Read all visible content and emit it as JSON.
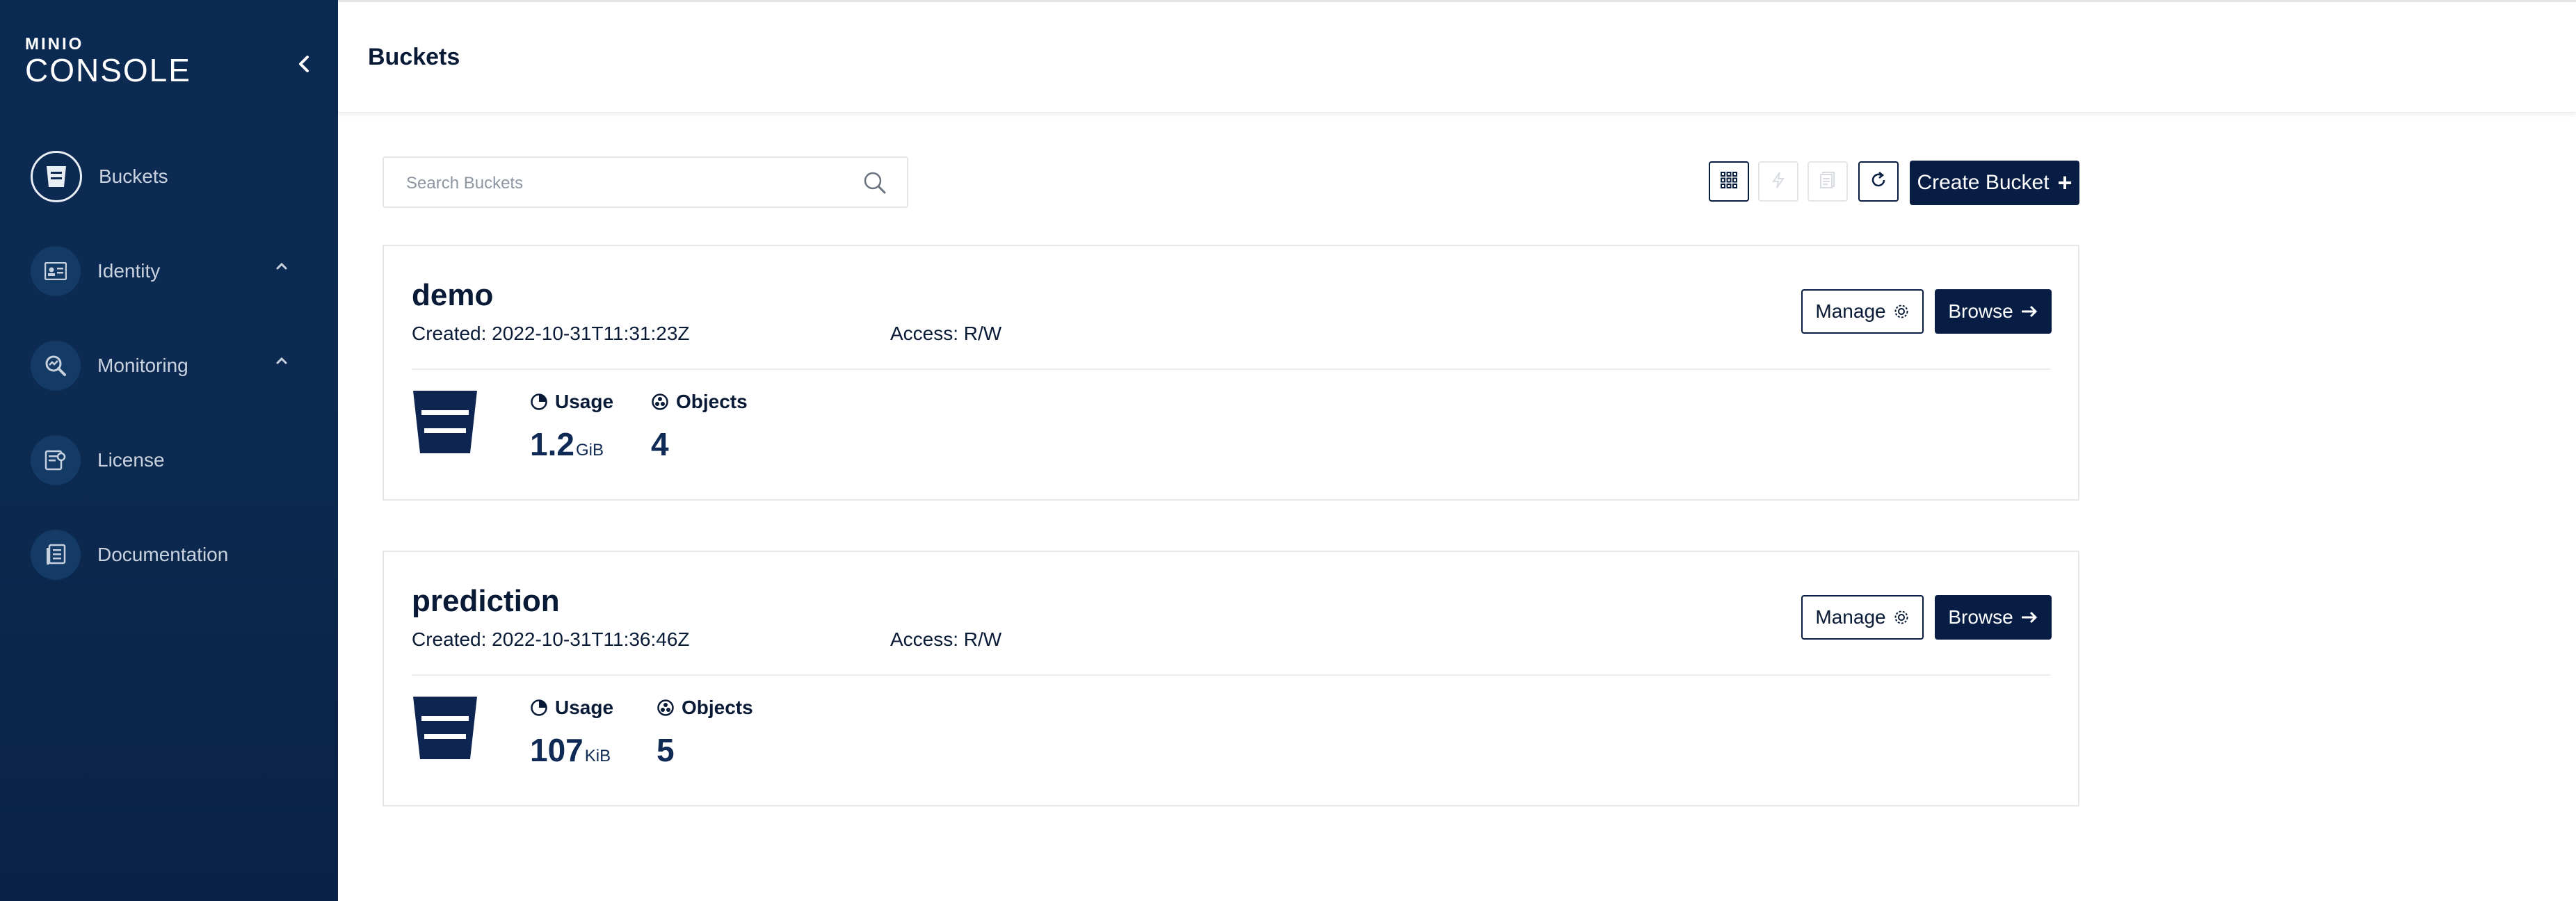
{
  "brand": {
    "small": "MINIO",
    "big": "CONSOLE"
  },
  "sidebar": {
    "items": [
      {
        "label": "Buckets",
        "icon": "bucket-icon",
        "active": true
      },
      {
        "label": "Identity",
        "icon": "id-card-icon",
        "expandable": true
      },
      {
        "label": "Monitoring",
        "icon": "monitoring-icon",
        "expandable": true
      },
      {
        "label": "License",
        "icon": "license-icon"
      },
      {
        "label": "Documentation",
        "icon": "documentation-icon"
      }
    ]
  },
  "header": {
    "title": "Buckets"
  },
  "toolbar": {
    "search_placeholder": "Search Buckets",
    "create_label": "Create Bucket"
  },
  "buckets": [
    {
      "name": "demo",
      "created": "Created: 2022-10-31T11:31:23Z",
      "access": "Access: R/W",
      "manage_label": "Manage",
      "browse_label": "Browse",
      "usage_label": "Usage",
      "usage_value": "1.2",
      "usage_unit": "GiB",
      "objects_label": "Objects",
      "objects_value": "4"
    },
    {
      "name": "prediction",
      "created": "Created: 2022-10-31T11:36:46Z",
      "access": "Access: R/W",
      "manage_label": "Manage",
      "browse_label": "Browse",
      "usage_label": "Usage",
      "usage_value": "107",
      "usage_unit": "KiB",
      "objects_label": "Objects",
      "objects_value": "5"
    }
  ],
  "colors": {
    "sidebar": "#0b2a52",
    "primary": "#081d44",
    "text": "#081a36"
  }
}
